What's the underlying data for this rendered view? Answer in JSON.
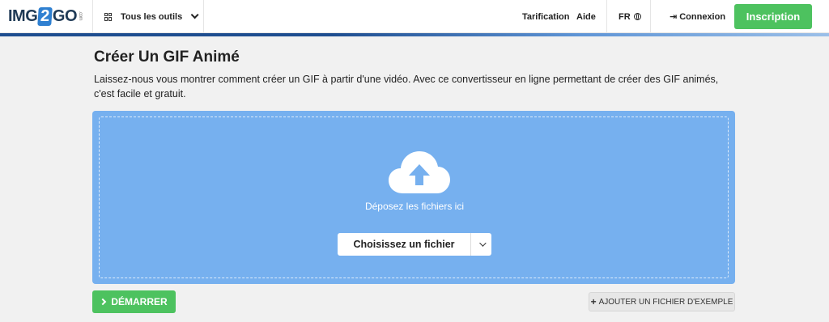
{
  "header": {
    "logo": {
      "part1": "IMG",
      "part2": "2",
      "part3": "GO",
      "suffix": ".com"
    },
    "tools_label": "Tous les outils",
    "pricing": "Tarification",
    "help": "Aide",
    "language": "FR",
    "login": "Connexion",
    "signup": "Inscription"
  },
  "main": {
    "title": "Créer Un GIF Animé",
    "description": "Laissez-nous vous montrer comment créer un GIF à partir d'une vidéo. Avec ce convertisseur en ligne permettant de créer des GIF animés, c'est facile et gratuit.",
    "dropzone": {
      "label": "Déposez les fichiers ici",
      "choose_button": "Choisissez un fichier"
    },
    "start_button": "DÉMARRER",
    "example_button": "AJOUTER UN FICHIER D'EXEMPLE"
  },
  "colors": {
    "accent_green": "#4dc25f",
    "dropzone_blue": "#76b0ef",
    "brand_blue": "#2f80d1"
  },
  "icons": [
    "grid-icon",
    "chevron-down-icon",
    "globe-icon",
    "login-icon",
    "cloud-upload-icon",
    "chevron-right-icon",
    "plus-icon"
  ]
}
